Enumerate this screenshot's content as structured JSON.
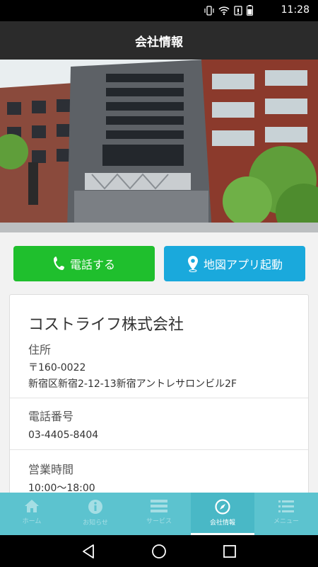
{
  "status_bar": {
    "time": "11:28",
    "icons": [
      "vibrate-icon",
      "wifi-icon",
      "battery-low-icon",
      "battery-icon"
    ]
  },
  "header": {
    "title": "会社情報"
  },
  "hero": {
    "image": "building-photo"
  },
  "actions": {
    "call_label": "電話する",
    "map_label": "地図アプリ起動",
    "call_color": "#1fbf2d",
    "map_color": "#1aa9dc"
  },
  "company": {
    "name": "コストライフ株式会社",
    "address_label": "住所",
    "postal": "〒160-0022",
    "address": "新宿区新宿2-12-13新宿アントレサロンビル2F",
    "phone_label": "電話番号",
    "phone": "03-4405-8404",
    "hours_label": "営業時間",
    "hours": "10:00〜18:00"
  },
  "tabs": [
    {
      "label": "ホーム",
      "icon": "home-icon"
    },
    {
      "label": "お知らせ",
      "icon": "info-icon"
    },
    {
      "label": "サービス",
      "icon": "list-icon"
    },
    {
      "label": "会社情報",
      "icon": "compass-icon",
      "active": true
    },
    {
      "label": "メニュー",
      "icon": "menu-icon"
    }
  ],
  "colors": {
    "tabbar": "#5cc3cf",
    "header": "#2b2b2b"
  }
}
